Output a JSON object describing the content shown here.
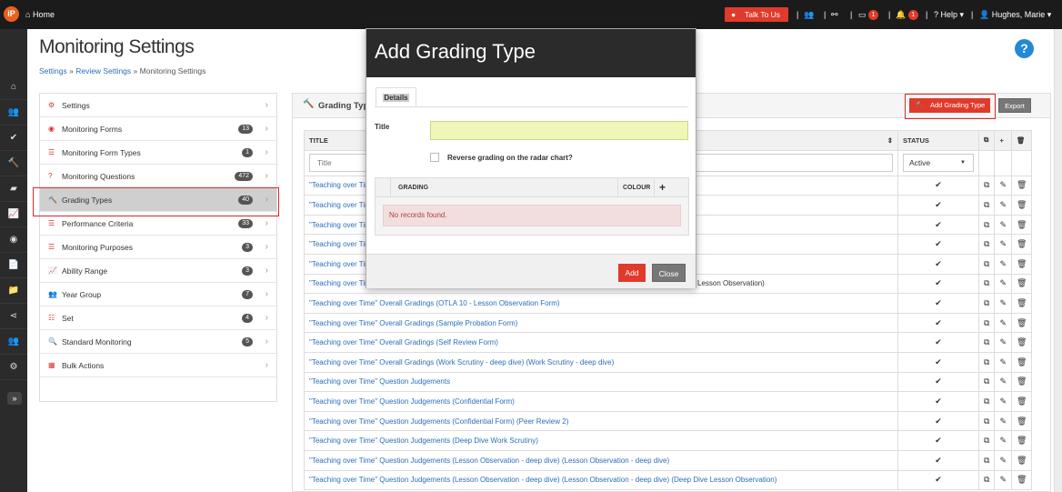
{
  "topbar": {
    "logo": "iP",
    "home_label": "Home",
    "talk_label": "Talk To Us",
    "messages_badge": "1",
    "notifications_badge": "1",
    "help_label": "Help",
    "user_name": "Hughes, Marie"
  },
  "page": {
    "title": "Monitoring Settings",
    "breadcrumb_settings": "Settings",
    "breadcrumb_sep": "»",
    "breadcrumb_review": "Review Settings",
    "breadcrumb_current": "Monitoring Settings",
    "help_icon": "?"
  },
  "menu": [
    {
      "label": "Settings",
      "count": "",
      "icon": "gears-icon"
    },
    {
      "label": "Monitoring Forms",
      "count": "13",
      "icon": "eye-icon"
    },
    {
      "label": "Monitoring Form Types",
      "count": "1",
      "icon": "list-icon"
    },
    {
      "label": "Monitoring Questions",
      "count": "472",
      "icon": "question-icon"
    },
    {
      "label": "Grading Types",
      "count": "40",
      "icon": "gavel-icon"
    },
    {
      "label": "Performance Criteria",
      "count": "33",
      "icon": "list-icon"
    },
    {
      "label": "Monitoring Purposes",
      "count": "3",
      "icon": "list-icon"
    },
    {
      "label": "Ability Range",
      "count": "3",
      "icon": "chart-icon"
    },
    {
      "label": "Year Group",
      "count": "7",
      "icon": "users-icon"
    },
    {
      "label": "Set",
      "count": "4",
      "icon": "sliders-icon"
    },
    {
      "label": "Standard Monitoring",
      "count": "5",
      "icon": "search-icon"
    },
    {
      "label": "Bulk Actions",
      "count": "",
      "icon": "grid-icon"
    }
  ],
  "panel": {
    "title": "Grading Types",
    "add_button": "Add Grading Type",
    "export_button": "Export",
    "col_title": "TITLE",
    "col_status": "STATUS",
    "title_placeholder": "Title",
    "status_filter": "Active",
    "rows": [
      "\"Teaching over Time\"",
      "\"Teaching over Time\"",
      "\"Teaching over Time\"",
      "\"Teaching over Time\"",
      "\"Teaching over Time\"",
      "\"Teaching over Time\"",
      "\"Teaching over Time\" Overall Gradings (OTLA 10 - Lesson Observation Form)",
      "\"Teaching over Time\" Overall Gradings (Sample Probation Form)",
      "\"Teaching over Time\" Overall Gradings (Self Review Form)",
      "\"Teaching over Time\" Overall Gradings (Work Scrutiny - deep dive) (Work Scrutiny - deep dive)",
      "\"Teaching over Time\" Question Judgements",
      "\"Teaching over Time\" Question Judgements (Confidential Form)",
      "\"Teaching over Time\" Question Judgements (Confidential Form) (Peer Review 2)",
      "\"Teaching over Time\" Question Judgements (Deep Dive Work Scrutiny)",
      "\"Teaching over Time\" Question Judgements (Lesson Observation - deep dive) (Lesson Observation - deep dive)",
      "\"Teaching over Time\" Question Judgements (Lesson Observation - deep dive) (Lesson Observation - deep dive) (Deep Dive Lesson Observation)"
    ],
    "row6_tail": "Lesson Observation)"
  },
  "modal": {
    "title": "Add Grading Type",
    "tab_details": "Details",
    "field_title_label": "Title",
    "title_value": "",
    "reverse_label": "Reverse grading on the radar chart?",
    "grid_col_grading": "GRADING",
    "grid_col_colour": "COLOUR",
    "no_records": "No records found.",
    "add_button": "Add",
    "close_button": "Close"
  }
}
